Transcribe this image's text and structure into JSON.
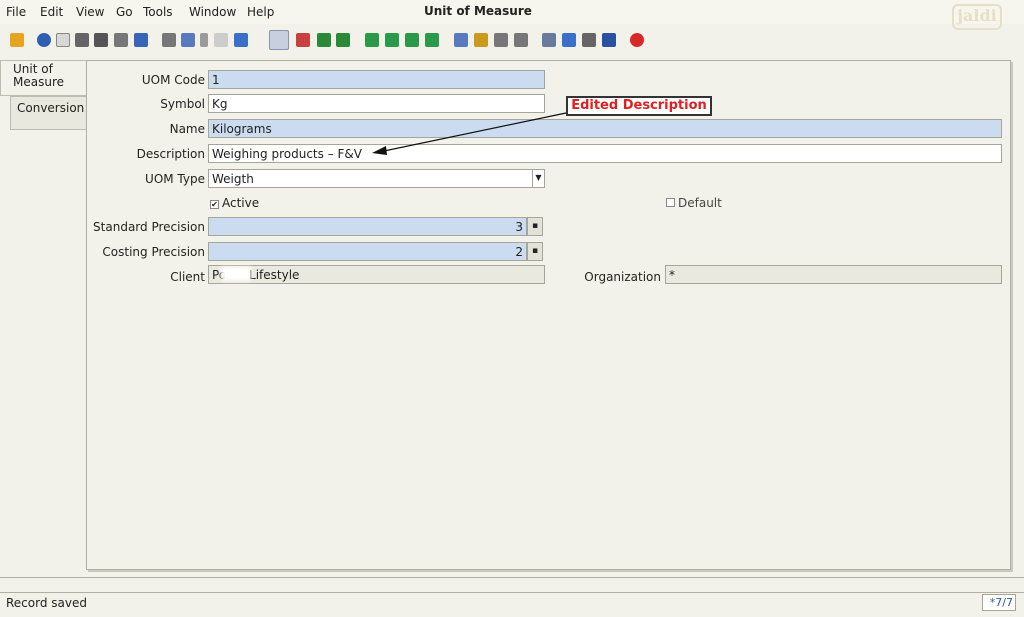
{
  "menu": {
    "items": [
      "File",
      "Edit",
      "View",
      "Go",
      "Tools",
      "Window",
      "Help"
    ],
    "window_title": "Unit of Measure",
    "logo_text": "jaldi"
  },
  "tabs": [
    {
      "label": "Unit of Measure",
      "active": true
    },
    {
      "label": "Conversion",
      "active": false
    }
  ],
  "form": {
    "uom_code": {
      "label": "UOM Code",
      "value": "1"
    },
    "symbol": {
      "label": "Symbol",
      "value": "Kg"
    },
    "name": {
      "label": "Name",
      "value": "Kilograms"
    },
    "description": {
      "label": "Description",
      "value": "Weighing products – F&V"
    },
    "uom_type": {
      "label": "UOM Type",
      "value": "Weigth"
    },
    "active": {
      "label": "Active",
      "checked": true
    },
    "default": {
      "label": "Default",
      "checked": false
    },
    "standard_precision": {
      "label": "Standard Precision",
      "value": "3"
    },
    "costing_precision": {
      "label": "Costing Precision",
      "value": "2"
    },
    "client": {
      "label": "Client",
      "value": "Po      Lifestyle"
    },
    "organization": {
      "label": "Organization",
      "value": "*"
    }
  },
  "annotation": {
    "text": "Edited Description"
  },
  "status": {
    "message": "Record saved",
    "record_count": "*7/7"
  },
  "colors": {
    "mandatory": "#cbdcf0",
    "accent_red": "#e02020"
  }
}
